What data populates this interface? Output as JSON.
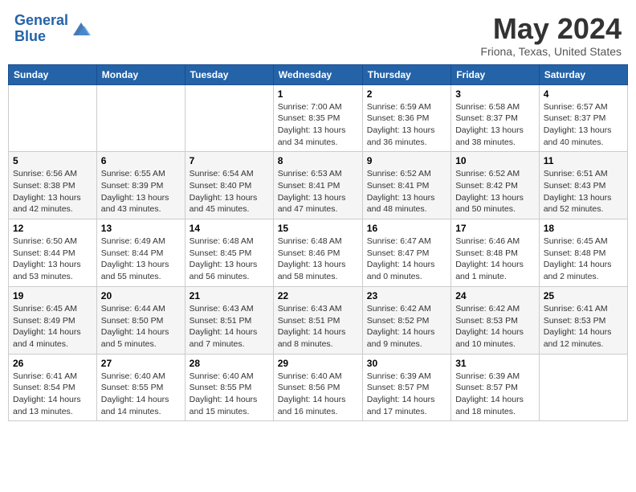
{
  "header": {
    "logo_line1": "General",
    "logo_line2": "Blue",
    "title": "May 2024",
    "subtitle": "Friona, Texas, United States"
  },
  "days_of_week": [
    "Sunday",
    "Monday",
    "Tuesday",
    "Wednesday",
    "Thursday",
    "Friday",
    "Saturday"
  ],
  "weeks": [
    [
      {
        "day": "",
        "info": ""
      },
      {
        "day": "",
        "info": ""
      },
      {
        "day": "",
        "info": ""
      },
      {
        "day": "1",
        "info": "Sunrise: 7:00 AM\nSunset: 8:35 PM\nDaylight: 13 hours\nand 34 minutes."
      },
      {
        "day": "2",
        "info": "Sunrise: 6:59 AM\nSunset: 8:36 PM\nDaylight: 13 hours\nand 36 minutes."
      },
      {
        "day": "3",
        "info": "Sunrise: 6:58 AM\nSunset: 8:37 PM\nDaylight: 13 hours\nand 38 minutes."
      },
      {
        "day": "4",
        "info": "Sunrise: 6:57 AM\nSunset: 8:37 PM\nDaylight: 13 hours\nand 40 minutes."
      }
    ],
    [
      {
        "day": "5",
        "info": "Sunrise: 6:56 AM\nSunset: 8:38 PM\nDaylight: 13 hours\nand 42 minutes."
      },
      {
        "day": "6",
        "info": "Sunrise: 6:55 AM\nSunset: 8:39 PM\nDaylight: 13 hours\nand 43 minutes."
      },
      {
        "day": "7",
        "info": "Sunrise: 6:54 AM\nSunset: 8:40 PM\nDaylight: 13 hours\nand 45 minutes."
      },
      {
        "day": "8",
        "info": "Sunrise: 6:53 AM\nSunset: 8:41 PM\nDaylight: 13 hours\nand 47 minutes."
      },
      {
        "day": "9",
        "info": "Sunrise: 6:52 AM\nSunset: 8:41 PM\nDaylight: 13 hours\nand 48 minutes."
      },
      {
        "day": "10",
        "info": "Sunrise: 6:52 AM\nSunset: 8:42 PM\nDaylight: 13 hours\nand 50 minutes."
      },
      {
        "day": "11",
        "info": "Sunrise: 6:51 AM\nSunset: 8:43 PM\nDaylight: 13 hours\nand 52 minutes."
      }
    ],
    [
      {
        "day": "12",
        "info": "Sunrise: 6:50 AM\nSunset: 8:44 PM\nDaylight: 13 hours\nand 53 minutes."
      },
      {
        "day": "13",
        "info": "Sunrise: 6:49 AM\nSunset: 8:44 PM\nDaylight: 13 hours\nand 55 minutes."
      },
      {
        "day": "14",
        "info": "Sunrise: 6:48 AM\nSunset: 8:45 PM\nDaylight: 13 hours\nand 56 minutes."
      },
      {
        "day": "15",
        "info": "Sunrise: 6:48 AM\nSunset: 8:46 PM\nDaylight: 13 hours\nand 58 minutes."
      },
      {
        "day": "16",
        "info": "Sunrise: 6:47 AM\nSunset: 8:47 PM\nDaylight: 14 hours\nand 0 minutes."
      },
      {
        "day": "17",
        "info": "Sunrise: 6:46 AM\nSunset: 8:48 PM\nDaylight: 14 hours\nand 1 minute."
      },
      {
        "day": "18",
        "info": "Sunrise: 6:45 AM\nSunset: 8:48 PM\nDaylight: 14 hours\nand 2 minutes."
      }
    ],
    [
      {
        "day": "19",
        "info": "Sunrise: 6:45 AM\nSunset: 8:49 PM\nDaylight: 14 hours\nand 4 minutes."
      },
      {
        "day": "20",
        "info": "Sunrise: 6:44 AM\nSunset: 8:50 PM\nDaylight: 14 hours\nand 5 minutes."
      },
      {
        "day": "21",
        "info": "Sunrise: 6:43 AM\nSunset: 8:51 PM\nDaylight: 14 hours\nand 7 minutes."
      },
      {
        "day": "22",
        "info": "Sunrise: 6:43 AM\nSunset: 8:51 PM\nDaylight: 14 hours\nand 8 minutes."
      },
      {
        "day": "23",
        "info": "Sunrise: 6:42 AM\nSunset: 8:52 PM\nDaylight: 14 hours\nand 9 minutes."
      },
      {
        "day": "24",
        "info": "Sunrise: 6:42 AM\nSunset: 8:53 PM\nDaylight: 14 hours\nand 10 minutes."
      },
      {
        "day": "25",
        "info": "Sunrise: 6:41 AM\nSunset: 8:53 PM\nDaylight: 14 hours\nand 12 minutes."
      }
    ],
    [
      {
        "day": "26",
        "info": "Sunrise: 6:41 AM\nSunset: 8:54 PM\nDaylight: 14 hours\nand 13 minutes."
      },
      {
        "day": "27",
        "info": "Sunrise: 6:40 AM\nSunset: 8:55 PM\nDaylight: 14 hours\nand 14 minutes."
      },
      {
        "day": "28",
        "info": "Sunrise: 6:40 AM\nSunset: 8:55 PM\nDaylight: 14 hours\nand 15 minutes."
      },
      {
        "day": "29",
        "info": "Sunrise: 6:40 AM\nSunset: 8:56 PM\nDaylight: 14 hours\nand 16 minutes."
      },
      {
        "day": "30",
        "info": "Sunrise: 6:39 AM\nSunset: 8:57 PM\nDaylight: 14 hours\nand 17 minutes."
      },
      {
        "day": "31",
        "info": "Sunrise: 6:39 AM\nSunset: 8:57 PM\nDaylight: 14 hours\nand 18 minutes."
      },
      {
        "day": "",
        "info": ""
      }
    ]
  ]
}
